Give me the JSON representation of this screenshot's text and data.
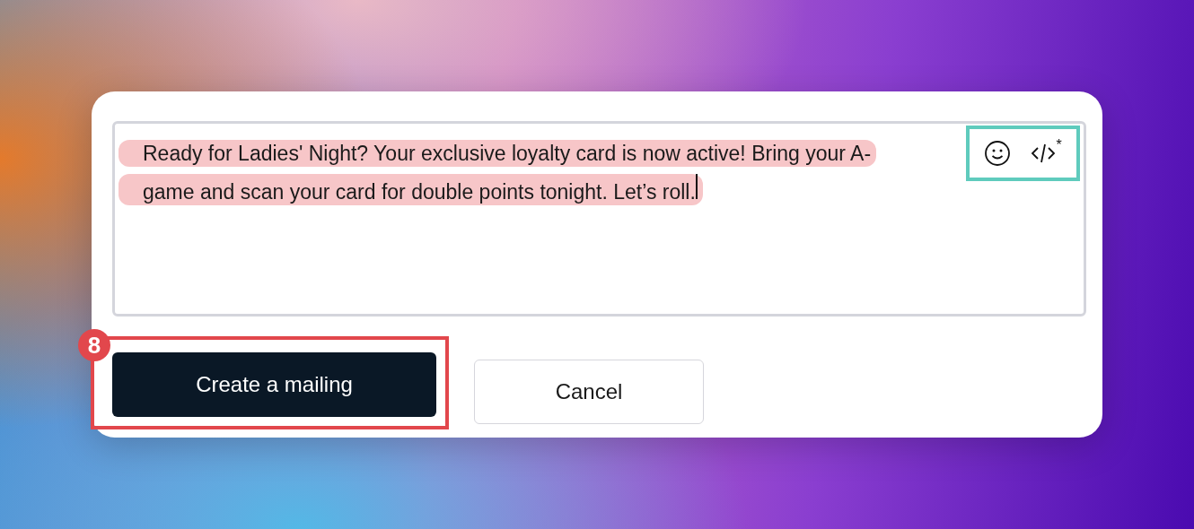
{
  "message_editor": {
    "lines": [
      "Ready for Ladies' Night? Your exclusive loyalty card is now active! Bring your A-",
      "game and scan your card for double points tonight. Let’s roll."
    ],
    "cursor": true,
    "toolbar": {
      "highlighted": true,
      "tools": [
        {
          "kind": "emoji"
        },
        {
          "kind": "code",
          "superscript": "*"
        }
      ]
    }
  },
  "buttons": [
    {
      "label": "Create a mailing",
      "kind": "primary",
      "highlighted": true,
      "step": "8"
    },
    {
      "label": "Cancel",
      "kind": "secondary",
      "highlighted": false
    }
  ]
}
